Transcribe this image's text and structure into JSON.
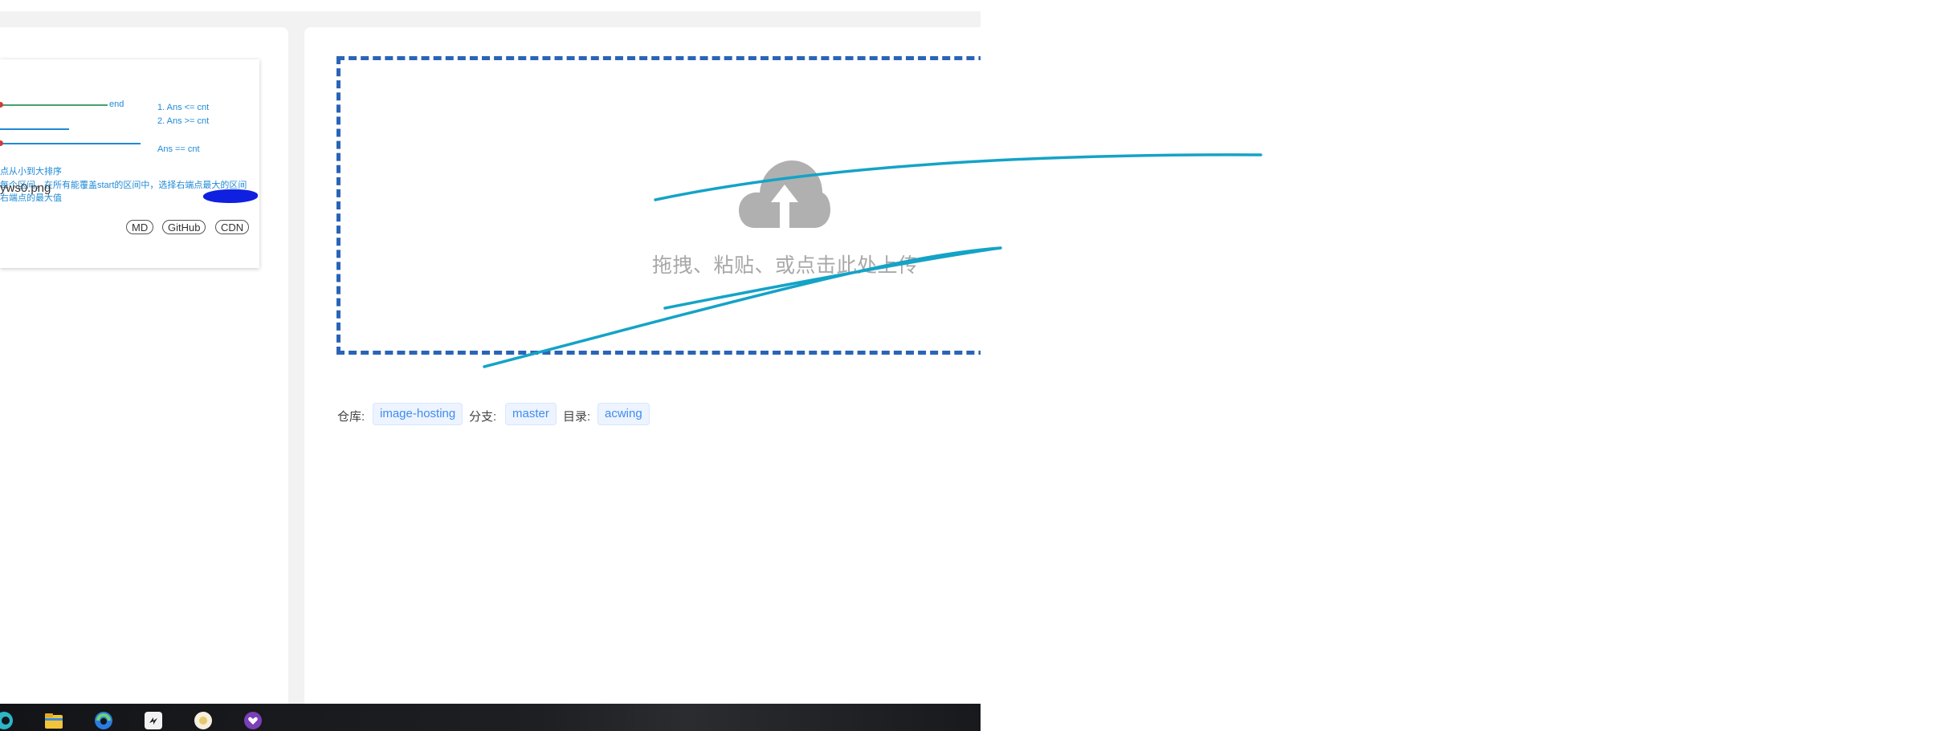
{
  "left_card": {
    "preview": {
      "end_label": "end",
      "conditions": [
        "1. Ans <= cnt",
        "2. Ans >= cnt"
      ],
      "equality": "Ans == cnt",
      "notes": [
        "点从小到大排序",
        "每个区间，在所有能覆盖start的区间中，选择右端点最大的区间",
        "右端点的最大值"
      ]
    },
    "filename": "yws0.png",
    "buttons": [
      "MD",
      "GitHub",
      "CDN"
    ]
  },
  "upload": {
    "hint": "拖拽、粘贴、或点击此处上传",
    "icon": "cloud-upload-icon"
  },
  "meta": {
    "repo_label": "仓库:",
    "repo_value": "image-hosting",
    "branch_label": "分支:",
    "branch_value": "master",
    "dir_label": "目录:",
    "dir_value": "acwing"
  },
  "taskbar": {
    "icons": [
      "edge-icon",
      "file-explorer-icon",
      "browser-icon",
      "terminal-icon",
      "app-icon",
      "heart-app-icon"
    ]
  },
  "colors": {
    "dropzone_border": "#2a64b7",
    "tag_text": "#3f8cef",
    "ink": "#14a3c7",
    "preview_text": "#1f8ad6"
  }
}
